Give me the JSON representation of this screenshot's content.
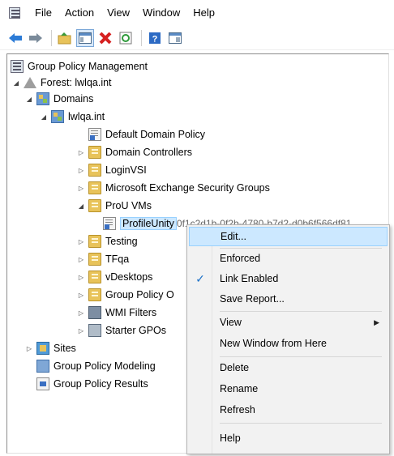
{
  "menubar": {
    "items": [
      "File",
      "Action",
      "View",
      "Window",
      "Help"
    ]
  },
  "toolbar": {
    "buttons": [
      "back-arrow-icon",
      "forward-arrow-icon",
      "up-folder-icon",
      "show-hide-tree-icon",
      "delete-icon",
      "refresh-icon",
      "help-icon",
      "properties-icon"
    ]
  },
  "tree": {
    "root": "Group Policy Management",
    "forest": "Forest: lwlqa.int",
    "domains": "Domains",
    "domain": "lwlqa.int",
    "default_policy": "Default Domain Policy",
    "domain_controllers": "Domain Controllers",
    "loginvsi": "LoginVSI",
    "exchange_groups": "Microsoft Exchange Security Groups",
    "prou_vms": "ProU VMs",
    "profileunity": "ProfileUnity",
    "profileunity_tail": "0f1c2d1b-0f2b-4780-b7d2-d0b6f566df81",
    "testing": "Testing",
    "tfqa": "TFqa",
    "vdesktops": "vDesktops",
    "gpo_objects": "Group Policy O",
    "wmi_filters": "WMI Filters",
    "starter_gpos": "Starter GPOs",
    "sites": "Sites",
    "modeling": "Group Policy Modeling",
    "results": "Group Policy Results"
  },
  "context_menu": {
    "edit": "Edit...",
    "enforced": "Enforced",
    "link_enabled": "Link Enabled",
    "link_enabled_check": "✓",
    "save_report": "Save Report...",
    "view": "View",
    "new_window": "New Window from Here",
    "delete": "Delete",
    "rename": "Rename",
    "refresh": "Refresh",
    "help": "Help"
  },
  "colors": {
    "selection": "#cce8ff",
    "selection_border": "#99d1ff",
    "menu_bg": "#f2f2f2",
    "check": "#1e72c9"
  }
}
